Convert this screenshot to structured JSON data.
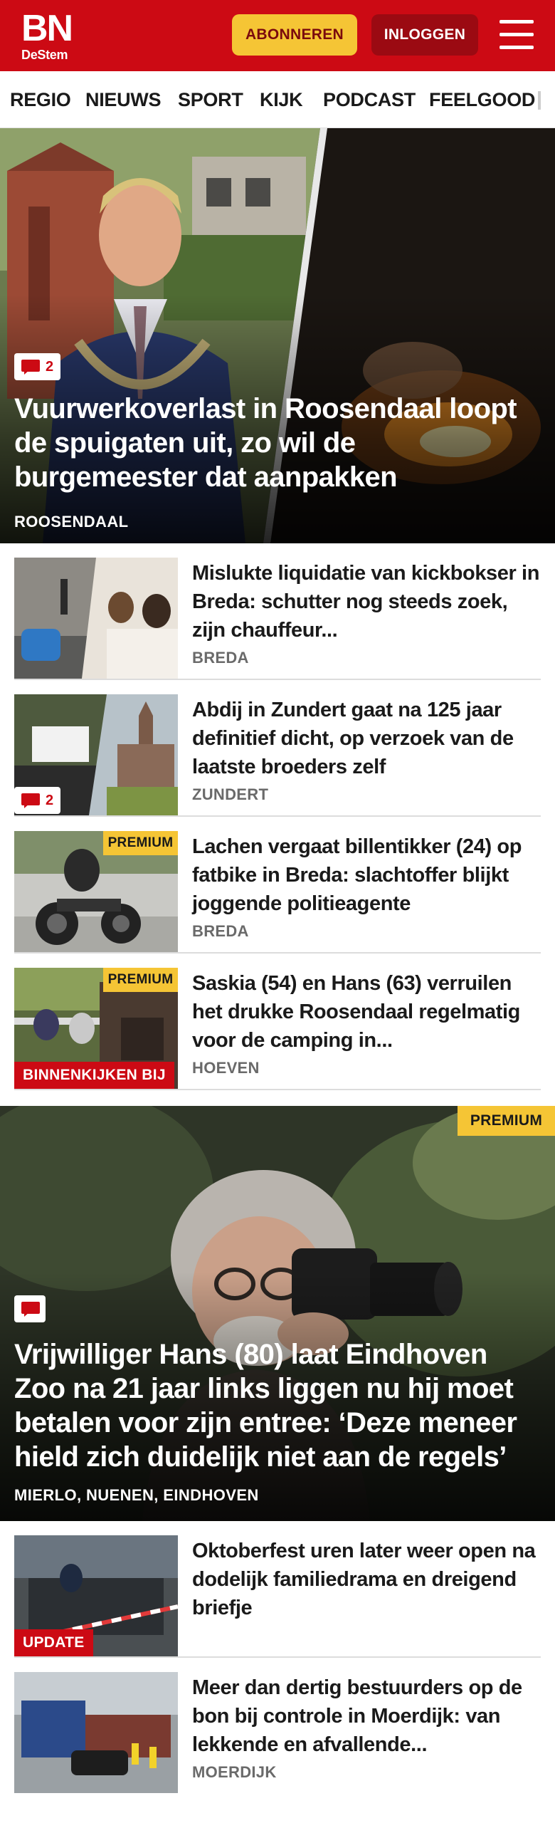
{
  "header": {
    "logo_main": "BN",
    "logo_sub": "DeStem",
    "subscribe_label": "ABONNEREN",
    "login_label": "INLOGGEN",
    "menu_icon": "hamburger-menu-icon",
    "brand_color": "#cc0a14",
    "accent_color": "#f5c535"
  },
  "nav": {
    "items": [
      "REGIO",
      "NIEUWS",
      "SPORT",
      "KIJK",
      "PODCAST",
      "FEELGOOD"
    ]
  },
  "hero": {
    "comment_count": "2",
    "title": "Vuurwerkoverlast in Roosendaal loopt de spuigaten uit, zo wil de burgemeester dat aanpakken",
    "location": "ROOSENDAAL"
  },
  "articles": [
    {
      "title": "Mislukte liquidatie van kickbokser in Breda: schutter nog steeds zoek, zijn chauffeur...",
      "location": "BREDA"
    },
    {
      "title": "Abdij in Zundert gaat na 125 jaar definitief dicht, op verzoek van de laatste broeders zelf",
      "location": "ZUNDERT",
      "comment_count": "2"
    },
    {
      "title": "Lachen vergaat billentikker (24) op fatbike in Breda: slachtoffer blijkt joggende politieagente",
      "location": "BREDA",
      "badge": "PREMIUM"
    },
    {
      "title": "Saskia (54) en Hans (63) verruilen het drukke Roosendaal regelmatig voor de camping in...",
      "location": "HOEVEN",
      "badge": "PREMIUM",
      "label": "BINNENKIJKEN BIJ"
    }
  ],
  "hero2": {
    "badge": "PREMIUM",
    "title": "Vrijwilliger Hans (80) laat Eindhoven Zoo na 21 jaar links liggen nu hij moet betalen voor zijn entree: ‘Deze meneer hield zich duidelijk niet aan de regels’",
    "location": "MIERLO, NUENEN, EINDHOVEN"
  },
  "articles2": [
    {
      "title": "Oktoberfest uren later weer open na dodelijk familiedrama en dreigend briefje",
      "label": "UPDATE"
    },
    {
      "title": "Meer dan dertig bestuurders op de bon bij controle in Moerdijk: van lekkende en afvallende...",
      "location": "MOERDIJK"
    }
  ]
}
